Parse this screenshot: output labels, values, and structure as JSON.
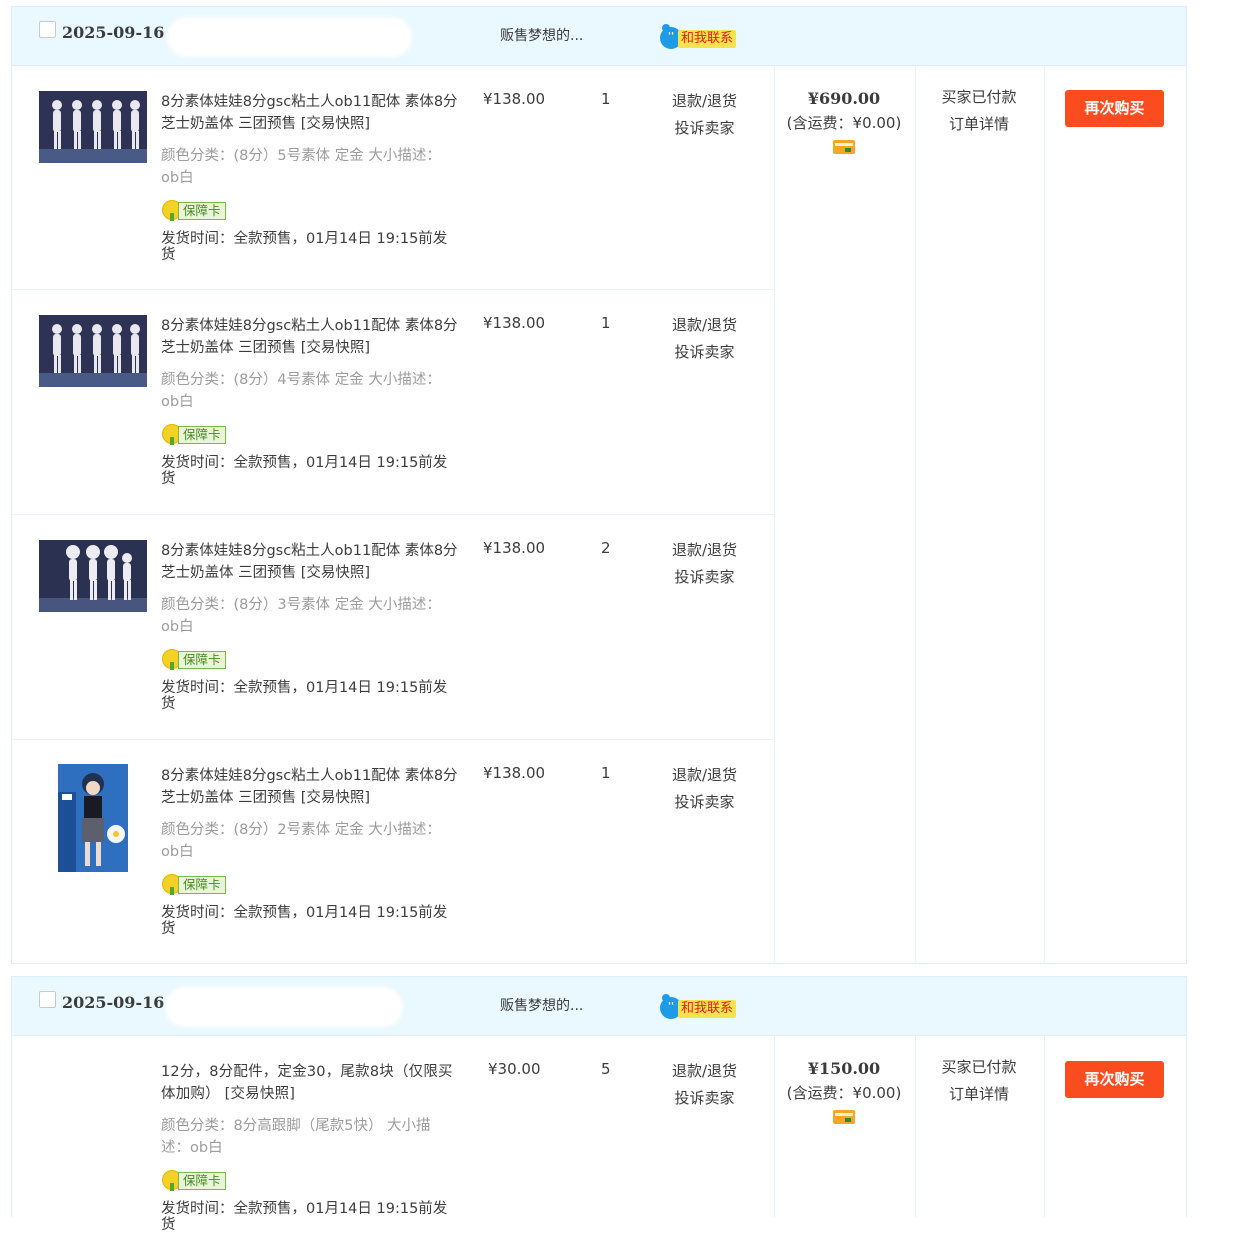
{
  "orders": [
    {
      "date": "2025-09-16",
      "shop": "贩售梦想的...",
      "contact_label": "和我联系",
      "total": "¥690.00",
      "shipping": "(含运费：¥0.00)",
      "status": "买家已付款",
      "detail_link": "订单详情",
      "rebuy_label": "再次购买",
      "items": [
        {
          "name": "8分素体娃娃8分gsc粘土人ob11配体 素体8分芝士奶盖体 三团预售 [交易快照]",
          "attrs": "颜色分类：(8分）5号素体 定金  大小描述：ob白",
          "badge": "保障卡",
          "ship": "发货时间：全款预售，01月14日 19:15前发货",
          "price": "¥138.00",
          "qty": "1",
          "refund": "退款/退货",
          "complain": "投诉卖家"
        },
        {
          "name": "8分素体娃娃8分gsc粘土人ob11配体 素体8分芝士奶盖体 三团预售 [交易快照]",
          "attrs": "颜色分类：(8分）4号素体 定金  大小描述：ob白",
          "badge": "保障卡",
          "ship": "发货时间：全款预售，01月14日 19:15前发货",
          "price": "¥138.00",
          "qty": "1",
          "refund": "退款/退货",
          "complain": "投诉卖家"
        },
        {
          "name": "8分素体娃娃8分gsc粘土人ob11配体 素体8分芝士奶盖体 三团预售 [交易快照]",
          "attrs": "颜色分类：(8分）3号素体 定金  大小描述：ob白",
          "badge": "保障卡",
          "ship": "发货时间：全款预售，01月14日 19:15前发货",
          "price": "¥138.00",
          "qty": "2",
          "refund": "退款/退货",
          "complain": "投诉卖家"
        },
        {
          "name": "8分素体娃娃8分gsc粘土人ob11配体 素体8分芝士奶盖体 三团预售 [交易快照]",
          "attrs": "颜色分类：(8分）2号素体 定金  大小描述：ob白",
          "badge": "保障卡",
          "ship": "发货时间：全款预售，01月14日 19:15前发货",
          "price": "¥138.00",
          "qty": "1",
          "refund": "退款/退货",
          "complain": "投诉卖家"
        }
      ]
    },
    {
      "date": "2025-09-16",
      "shop": "贩售梦想的...",
      "contact_label": "和我联系",
      "total": "¥150.00",
      "shipping": "(含运费：¥0.00)",
      "status": "买家已付款",
      "detail_link": "订单详情",
      "rebuy_label": "再次购买",
      "items": [
        {
          "name": "12分，8分配件，定金30，尾款8块（仅限买体加购） [交易快照]",
          "attrs": "颜色分类：8分高跟脚（尾款5快）  大小描述：ob白",
          "badge": "保障卡",
          "ship": "发货时间：全款预售，01月14日 19:15前发货",
          "price": "¥30.00",
          "qty": "5",
          "refund": "退款/退货",
          "complain": "投诉卖家"
        }
      ]
    }
  ],
  "colors": {
    "header_bg": "#eaf8ff",
    "rebuy_btn": "#fb4c1f",
    "border": "#dceffb"
  },
  "icons": [
    "checkbox-icon",
    "contact-bubble-icon",
    "guarantee-badge-icon",
    "payment-card-icon"
  ]
}
